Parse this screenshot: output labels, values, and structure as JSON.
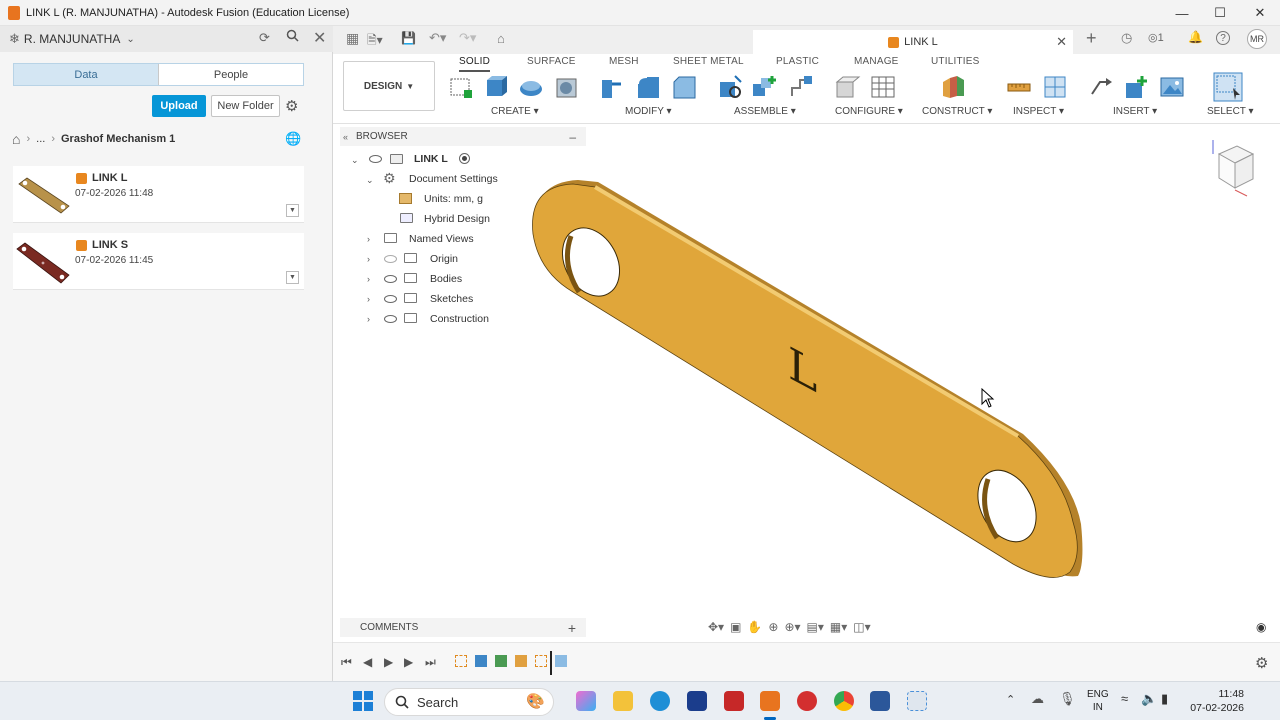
{
  "window": {
    "title": "LINK L (R. MANJUNATHA) - Autodesk Fusion (Education License)"
  },
  "user": {
    "name": "R. MANJUNATHA"
  },
  "data_panel": {
    "tabs": [
      {
        "label": "Data",
        "active": true
      },
      {
        "label": "People",
        "active": false
      }
    ],
    "upload_label": "Upload",
    "new_folder_label": "New Folder",
    "breadcrumb": {
      "ellipsis": "...",
      "project": "Grashof Mechanism 1"
    },
    "files": [
      {
        "name": "LINK L",
        "date": "07-02-2026 11:48",
        "color": "#b8924a"
      },
      {
        "name": "LINK S",
        "date": "07-02-2026 11:45",
        "color": "#7a2a22"
      }
    ]
  },
  "document_tab": {
    "label": "LINK L"
  },
  "header_right": {
    "jobs_count": "1",
    "avatar": "MR"
  },
  "toolbar": {
    "design_label": "DESIGN",
    "tabs": [
      "SOLID",
      "SURFACE",
      "MESH",
      "SHEET METAL",
      "PLASTIC",
      "MANAGE",
      "UTILITIES"
    ],
    "active_tab": "SOLID",
    "groups": [
      "CREATE",
      "MODIFY",
      "ASSEMBLE",
      "CONFIGURE",
      "CONSTRUCT",
      "INSPECT",
      "INSERT",
      "SELECT"
    ]
  },
  "browser": {
    "header": "BROWSER",
    "root": "LINK L",
    "doc_settings": "Document Settings",
    "units": "Units: mm, g",
    "hybrid": "Hybrid Design",
    "named_views": "Named Views",
    "origin": "Origin",
    "bodies": "Bodies",
    "sketches": "Sketches",
    "construction": "Construction"
  },
  "comments_label": "COMMENTS",
  "model": {
    "engraved_letter": "L",
    "color": "#e0a63a"
  },
  "taskbar": {
    "search_label": "Search",
    "lang_line1": "ENG",
    "lang_line2": "IN",
    "time": "11:48",
    "date": "07-02-2026"
  }
}
